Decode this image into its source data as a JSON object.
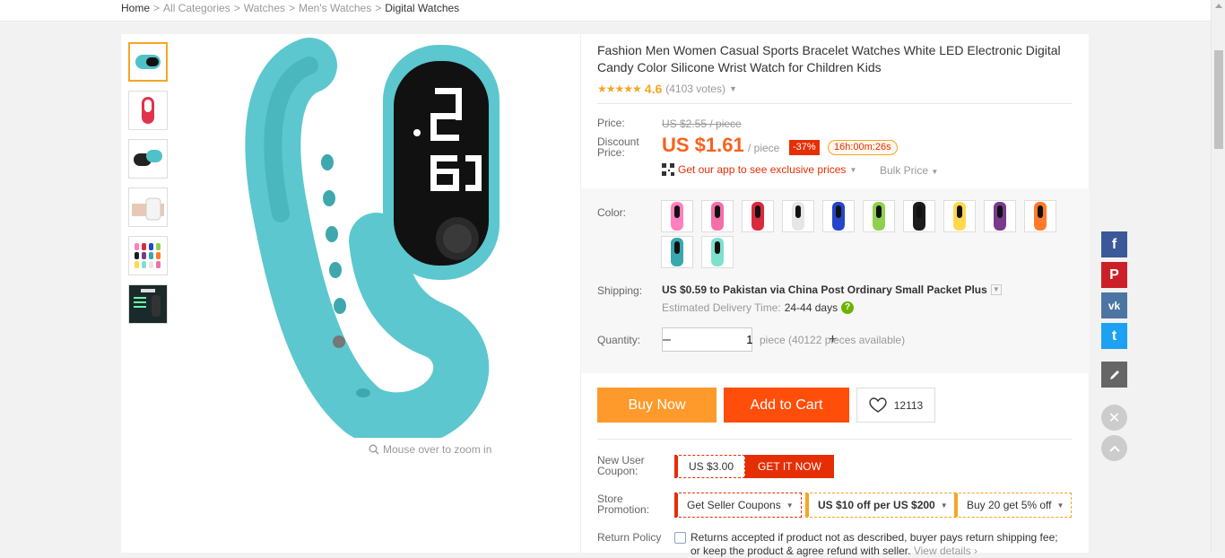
{
  "breadcrumb": [
    "Home",
    "All Categories",
    "Watches",
    "Men's Watches",
    "Digital Watches"
  ],
  "product": {
    "title": "Fashion Men Women Casual Sports Bracelet Watches White LED Electronic Digital Candy Color Silicone Wrist Watch for Children Kids",
    "rating_stars": "★★★★★",
    "rating_score": "4.6",
    "rating_votes": "(4103 votes)",
    "zoom_hint": "Mouse over to zoom in"
  },
  "thumbnails": [
    "teal-watch",
    "red-watch",
    "black-teal-watches",
    "white-watch-on-wrist",
    "color-grid",
    "details-dark"
  ],
  "thumb_colors": [
    "#4fc1c9",
    "#e0334b",
    "#222222",
    "#eeeeee",
    "#888888",
    "#1a2a2a"
  ],
  "pricing": {
    "price_label": "Price:",
    "original_price": "US $2.55 / piece",
    "discount_label": "Discount Price:",
    "discount_price": "US $1.61",
    "per_piece": "/ piece",
    "discount_percent": "-37%",
    "countdown": "16h:00m:26s",
    "app_link": "Get our app to see exclusive prices",
    "bulk_price": "Bulk Price"
  },
  "options": {
    "color_label": "Color:",
    "colors": [
      "#ff7fbf",
      "#f26fa8",
      "#d92a3d",
      "#e6e6e6",
      "#2447c9",
      "#8fd14f",
      "#1c1c1c",
      "#ffd84d",
      "#7a3a8c",
      "#ff7a2b",
      "#3aa6ad",
      "#7fe0cc"
    ],
    "shipping_label": "Shipping:",
    "shipping_text": "US $0.59 to Pakistan via China Post Ordinary Small Packet Plus",
    "delivery_label": "Estimated Delivery Time:",
    "delivery_days": "24-44 days",
    "quantity_label": "Quantity:",
    "quantity_value": "1",
    "quantity_available": "piece (40122 pieces available)"
  },
  "actions": {
    "buy_now": "Buy Now",
    "add_to_cart": "Add to Cart",
    "wishlist_count": "12113"
  },
  "coupons": {
    "new_user_label": "New User Coupon:",
    "new_user_amount": "US $3.00",
    "get_it_now": "GET IT NOW",
    "store_promo_label": "Store Promotion:",
    "promos": [
      "Get Seller Coupons",
      "US $10 off per US $200",
      "Buy 20 get 5% off"
    ],
    "return_label": "Return Policy",
    "return_text": "Returns accepted if product not as described, buyer pays return shipping fee; or keep the product & agree refund with seller.",
    "return_link": "View details ›"
  },
  "social": {
    "facebook": "f",
    "pinterest": "P",
    "vk": "vk",
    "twitter": "t",
    "colors": {
      "facebook": "#3b5998",
      "pinterest": "#cb2027",
      "vk": "#4c75a3",
      "twitter": "#1da1f2",
      "edit": "#666666"
    }
  },
  "accent": {
    "orange": "#f5621e",
    "red": "#e62e04",
    "gold": "#f5a623"
  }
}
